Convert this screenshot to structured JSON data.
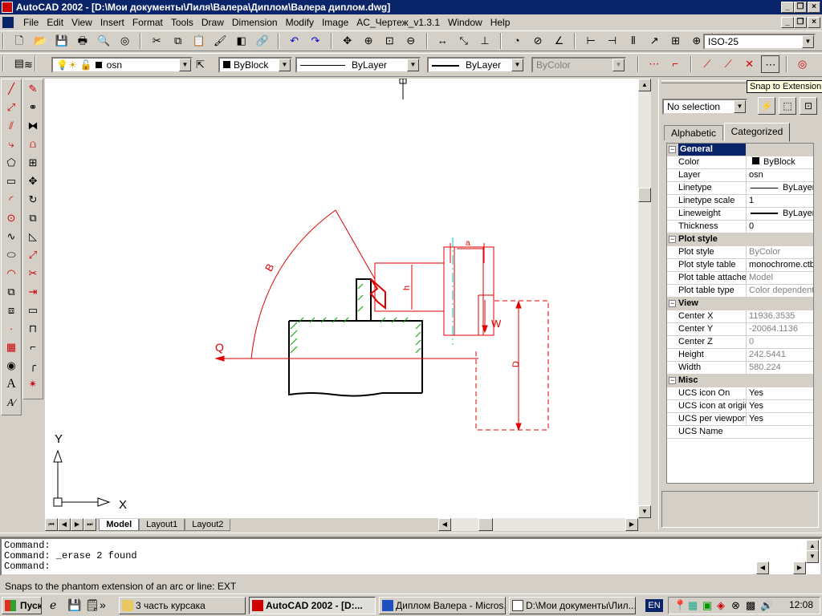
{
  "window": {
    "title": "AutoCAD 2002 - [D:\\Мои документы\\Лиля\\Валера\\Диплом\\Валера диплом.dwg]"
  },
  "menu": [
    "File",
    "Edit",
    "View",
    "Insert",
    "Format",
    "Tools",
    "Draw",
    "Dimension",
    "Modify",
    "Image",
    "AC_Чертеж_v1.3.1",
    "Window",
    "Help"
  ],
  "toolbar": {
    "dimstyle": "ISO-25",
    "layer": "osn",
    "color": "ByBlock",
    "linetype": "ByLayer",
    "lineweight": "ByLayer",
    "plotstyle": "ByColor"
  },
  "tooltip": "Snap to Extension",
  "properties": {
    "selection": "No selection",
    "tabs": [
      "Alphabetic",
      "Categorized"
    ],
    "rows": [
      {
        "type": "cat",
        "label": "General"
      },
      {
        "type": "row",
        "label": "Color",
        "value": "ByBlock"
      },
      {
        "type": "row",
        "label": "Layer",
        "value": "osn"
      },
      {
        "type": "row",
        "label": "Linetype",
        "value": "ByLayer"
      },
      {
        "type": "row",
        "label": "Linetype scale",
        "value": "1"
      },
      {
        "type": "row",
        "label": "Lineweight",
        "value": "ByLayer"
      },
      {
        "type": "row",
        "label": "Thickness",
        "value": "0"
      },
      {
        "type": "cat",
        "label": "Plot style"
      },
      {
        "type": "row",
        "label": "Plot style",
        "value": "ByColor",
        "grey": true
      },
      {
        "type": "row",
        "label": "Plot style table",
        "value": "monochrome.ctb"
      },
      {
        "type": "row",
        "label": "Plot table attache",
        "value": "Model",
        "grey": true
      },
      {
        "type": "row",
        "label": "Plot table type",
        "value": "Color dependent",
        "grey": true
      },
      {
        "type": "cat",
        "label": "View"
      },
      {
        "type": "row",
        "label": "Center X",
        "value": "11936.3535",
        "grey": true
      },
      {
        "type": "row",
        "label": "Center Y",
        "value": "-20064.1136",
        "grey": true
      },
      {
        "type": "row",
        "label": "Center Z",
        "value": "0",
        "grey": true
      },
      {
        "type": "row",
        "label": "Height",
        "value": "242.5441",
        "grey": true
      },
      {
        "type": "row",
        "label": "Width",
        "value": "580.224",
        "grey": true
      },
      {
        "type": "cat",
        "label": "Misc"
      },
      {
        "type": "row",
        "label": "UCS icon On",
        "value": "Yes"
      },
      {
        "type": "row",
        "label": "UCS icon at origin",
        "value": "Yes"
      },
      {
        "type": "row",
        "label": "UCS per viewport",
        "value": "Yes"
      },
      {
        "type": "row",
        "label": "UCS Name",
        "value": ""
      }
    ]
  },
  "layout_tabs": [
    "Model",
    "Layout1",
    "Layout2"
  ],
  "drawing": {
    "label_q": "Q",
    "label_b": "B",
    "label_h": "h",
    "label_a": "a",
    "label_w": "W",
    "label_d": "D",
    "axis_x": "X",
    "axis_y": "Y"
  },
  "command": [
    "Command:",
    "Command: _erase 2 found",
    "Command:"
  ],
  "status": "Snaps to the phantom extension of an arc or line:  EXT",
  "taskbar": {
    "start": "Пуск",
    "items": [
      "3 часть курсака",
      "AutoCAD 2002 - [D:...",
      "Диплом Валера - Micros...",
      "D:\\Мои документы\\Лил..."
    ],
    "lang": "EN",
    "clock": "12:08"
  },
  "colors": {
    "accent": "#0a246a",
    "drawing_red": "#e00000",
    "drawing_black": "#000000",
    "hatch": "#00a000",
    "cyan": "#00c8c8"
  }
}
